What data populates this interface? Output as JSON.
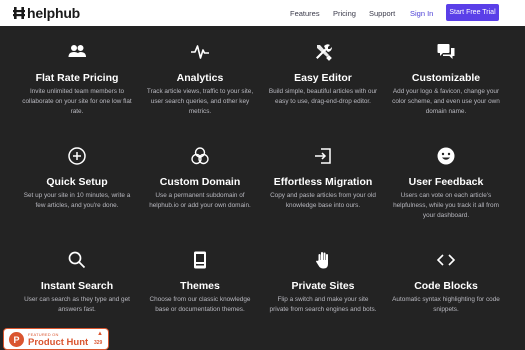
{
  "header": {
    "logo_text": "helphub",
    "nav": {
      "features": "Features",
      "pricing": "Pricing",
      "support": "Support",
      "signin": "Sign In"
    },
    "cta_label": "Start Free Trial"
  },
  "colors": {
    "background": "#232323",
    "accent": "#5a3fe8",
    "product_hunt": "#da552f"
  },
  "features": [
    {
      "icon": "users-icon",
      "title": "Flat Rate Pricing",
      "desc": "Invite unlimited team members to collaborate on your site for one low flat rate."
    },
    {
      "icon": "pulse-icon",
      "title": "Analytics",
      "desc": "Track article views, traffic to your site, user search queries, and other key metrics."
    },
    {
      "icon": "tools-icon",
      "title": "Easy Editor",
      "desc": "Build simple, beautiful articles with our easy to use, drag-end-drop editor."
    },
    {
      "icon": "chat-icon",
      "title": "Customizable",
      "desc": "Add your logo & favicon, change your color scheme, and even use your own domain name."
    },
    {
      "icon": "plus-circle-icon",
      "title": "Quick Setup",
      "desc": "Set up your site in 10 minutes, write a few articles, and you're done."
    },
    {
      "icon": "circles-icon",
      "title": "Custom Domain",
      "desc": "Use a permanent subdomain of helphub.io or add your own domain."
    },
    {
      "icon": "import-icon",
      "title": "Effortless Migration",
      "desc": "Copy and paste articles from your old knowledge base into ours."
    },
    {
      "icon": "smile-icon",
      "title": "User Feedback",
      "desc": "Users can vote on each article's helpfulness, while you track it all from your dashboard."
    },
    {
      "icon": "search-icon",
      "title": "Instant Search",
      "desc": "User can search as they type and get answers fast."
    },
    {
      "icon": "theme-icon",
      "title": "Themes",
      "desc": "Choose from our classic knowledge base or documentation themes."
    },
    {
      "icon": "hand-icon",
      "title": "Private Sites",
      "desc": "Flip a switch and make your site private from search engines and bots."
    },
    {
      "icon": "code-icon",
      "title": "Code Blocks",
      "desc": "Automatic syntax highlighting for code snippets."
    }
  ],
  "product_hunt": {
    "featured_on": "FEATURED ON",
    "name": "Product Hunt",
    "upvote_icon": "upvote-arrow-icon",
    "count": "329"
  }
}
